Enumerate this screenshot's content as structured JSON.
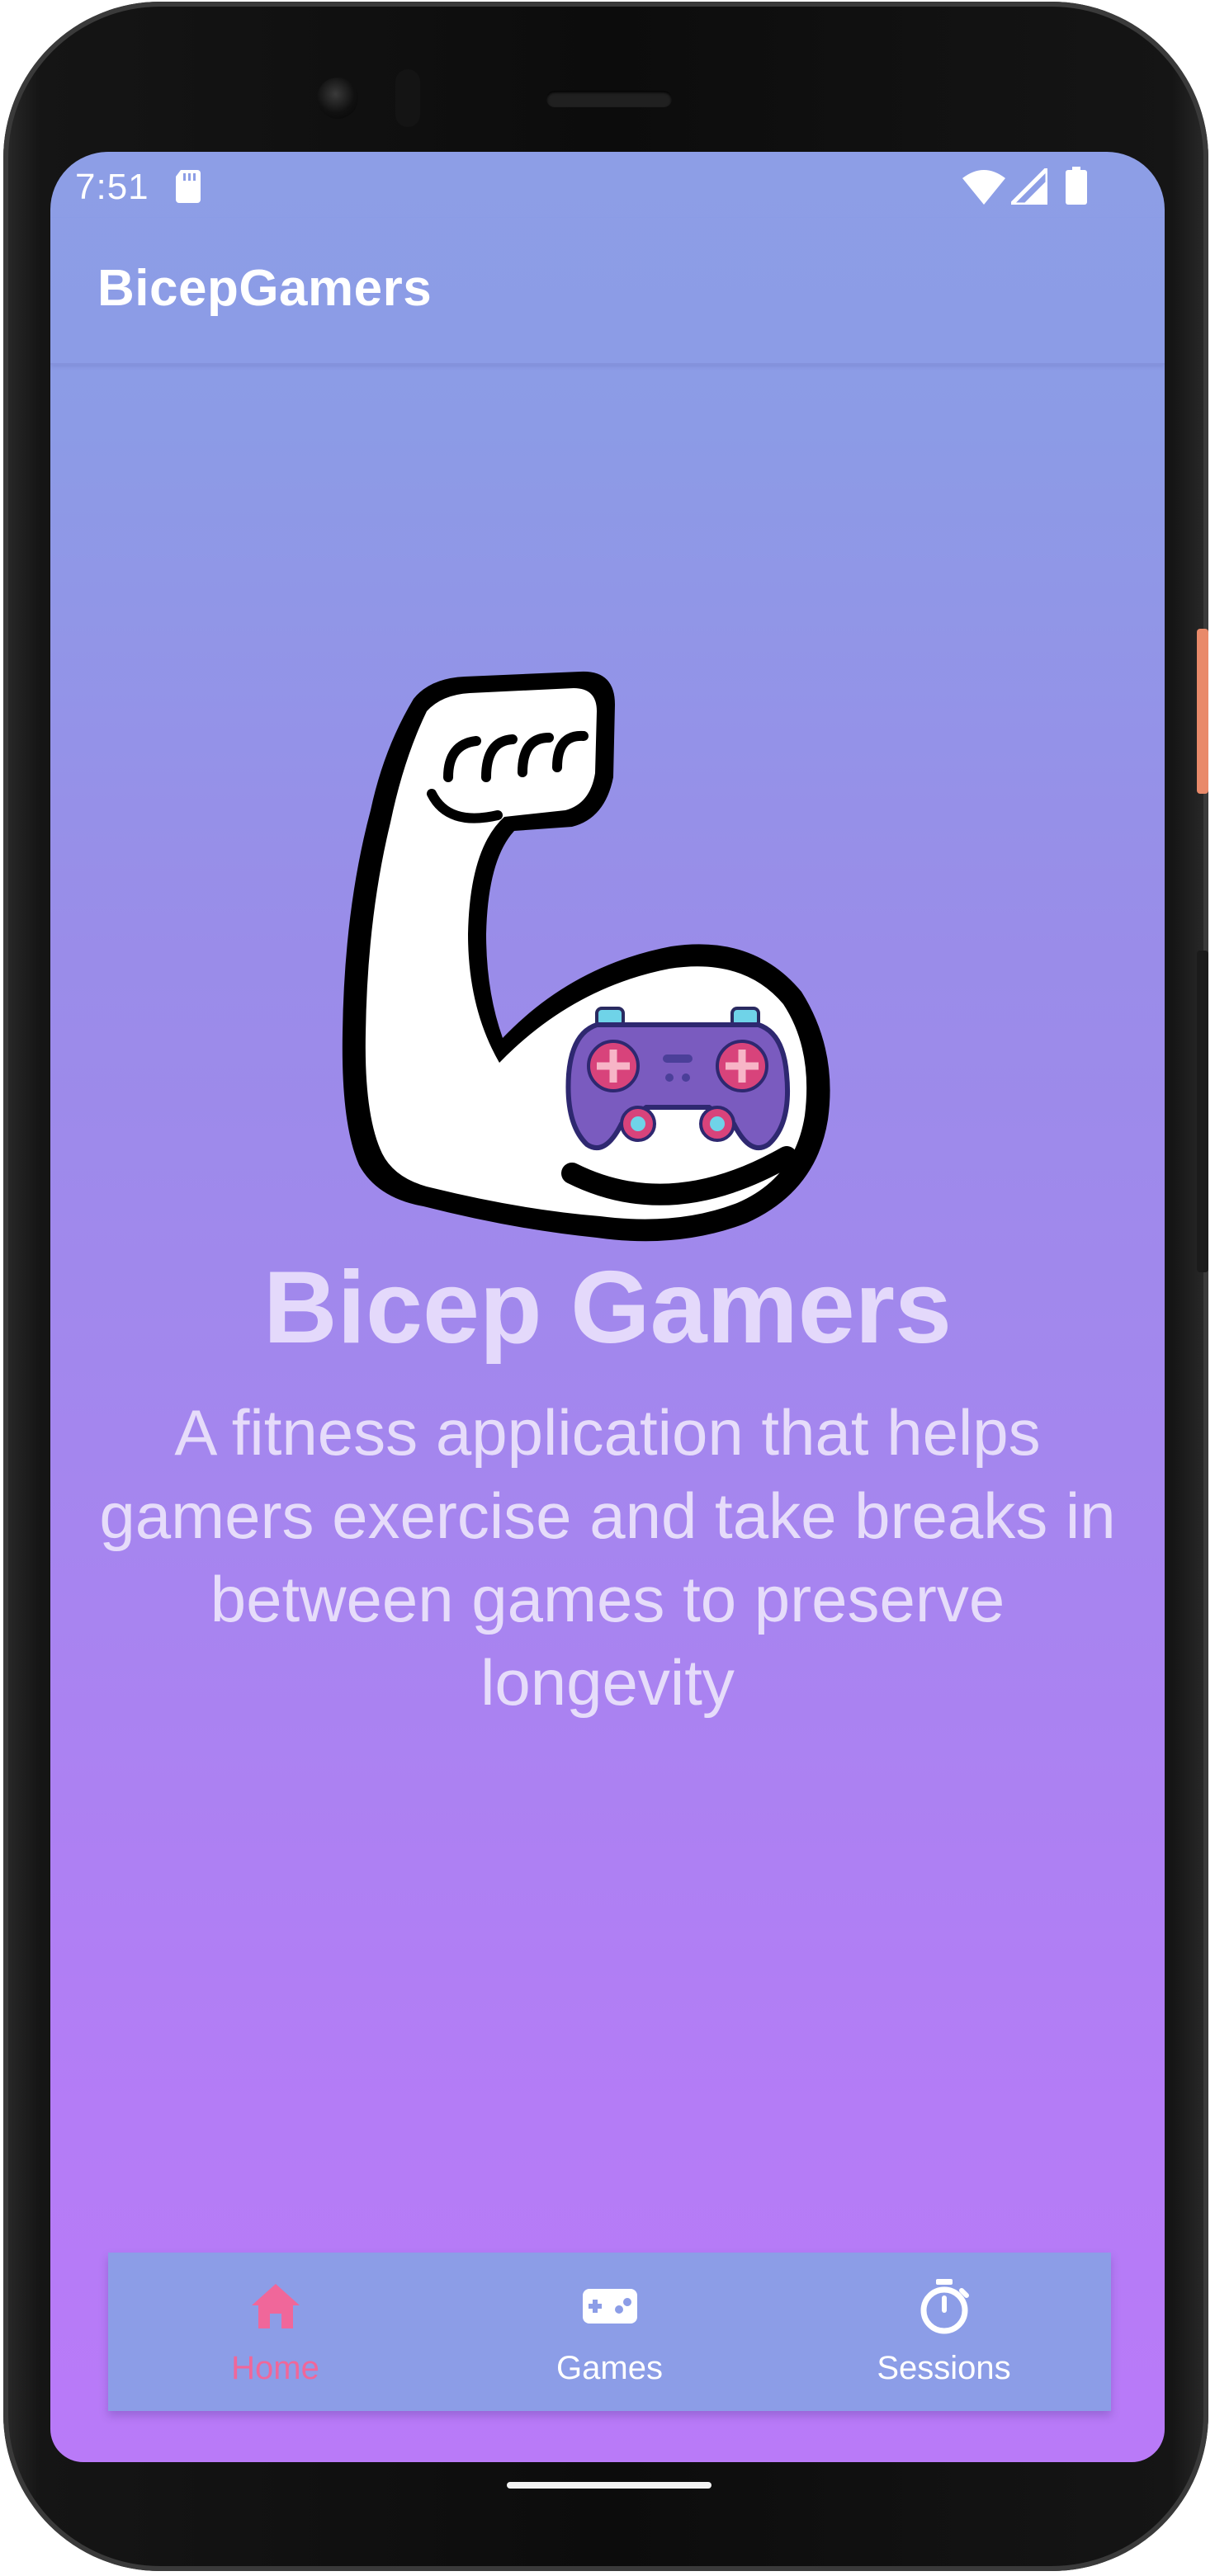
{
  "status_bar": {
    "time": "7:51",
    "icons": [
      "sd-card-icon",
      "wifi-icon",
      "signal-icon",
      "battery-icon"
    ]
  },
  "app_bar": {
    "title": "BicepGamers"
  },
  "hero": {
    "logo_icon": "flexed-bicep-with-gamepad-icon",
    "title": "Bicep Gamers",
    "description": "A fitness application that helps gamers exercise and take breaks in between games to preserve longevity"
  },
  "bottom_nav": {
    "items": [
      {
        "label": "Home",
        "icon": "home-icon",
        "active": true
      },
      {
        "label": "Games",
        "icon": "gamepad-icon",
        "active": false
      },
      {
        "label": "Sessions",
        "icon": "stopwatch-icon",
        "active": false
      }
    ]
  },
  "colors": {
    "gradient_top": "#8d9ee6",
    "gradient_bottom": "#b97af8",
    "nav_background": "#8c9de7",
    "active_accent": "#f0679a",
    "hero_text": "#e4d9fb"
  }
}
